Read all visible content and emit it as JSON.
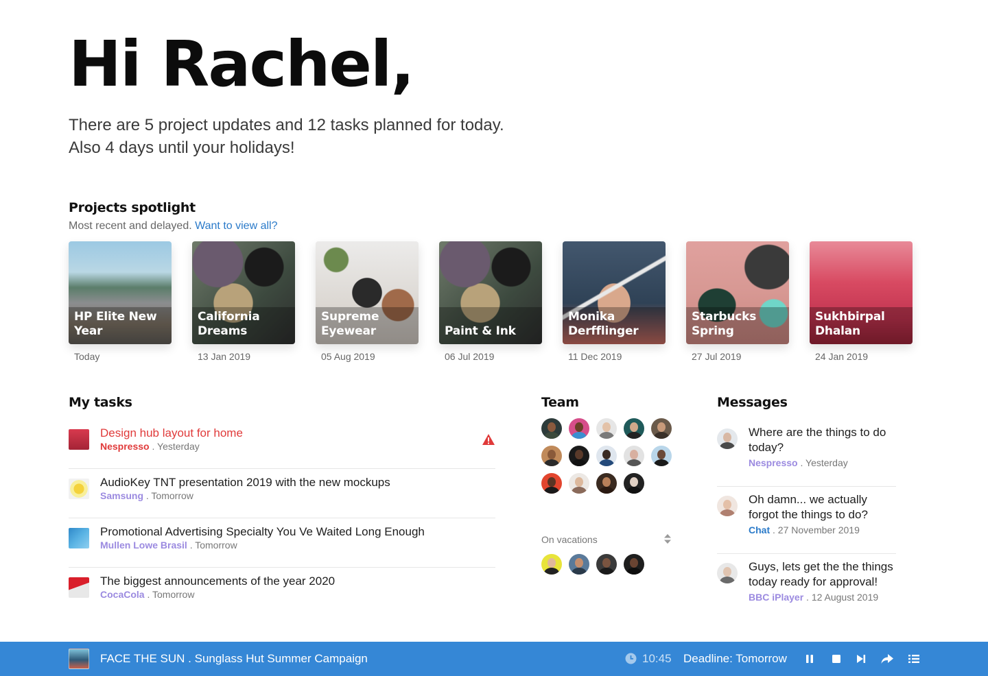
{
  "greeting": "Hi Rachel,",
  "intro": {
    "line1": "There are 5 project updates and 12 tasks planned for today.",
    "line2": "Also 4 days until your holidays!"
  },
  "spotlight": {
    "title": "Projects spotlight",
    "subtitle": "Most recent and delayed.",
    "link": "Want to view all?",
    "projects": [
      {
        "title": "HP Elite New Year",
        "date": "Today"
      },
      {
        "title": "California Dreams",
        "date": "13 Jan 2019"
      },
      {
        "title": "Supreme Eyewear",
        "date": "05 Aug 2019"
      },
      {
        "title": "Paint & Ink",
        "date": "06 Jul 2019"
      },
      {
        "title": "Monika Derfflinger",
        "date": "11 Dec 2019"
      },
      {
        "title": "Starbucks Spring",
        "date": "27 Jul 2019"
      },
      {
        "title": "Sukhbirpal Dhalan",
        "date": "24 Jan 2019"
      }
    ]
  },
  "tasks": {
    "title": "My tasks",
    "items": [
      {
        "title": "Design hub layout for home",
        "client": "Nespresso",
        "when": " . Yesterday"
      },
      {
        "title": "AudioKey TNT presentation 2019 with the new mockups",
        "client": "Samsung",
        "when": " . Tomorrow"
      },
      {
        "title": "Promotional Advertising Specialty You Ve Waited Long Enough",
        "client": "Mullen Lowe Brasil",
        "when": " . Tomorrow"
      },
      {
        "title": "The biggest announcements of the year 2020",
        "client": "CocaCola",
        "when": " . Tomorrow"
      }
    ]
  },
  "team": {
    "title": "Team",
    "vacations_label": "On vacations"
  },
  "messages": {
    "title": "Messages",
    "items": [
      {
        "text": "Where are the things to do today?",
        "client": "Nespresso",
        "when": " . Yesterday"
      },
      {
        "text": "Oh damn... we actually forgot the things to do?",
        "client": "Chat",
        "when": " . 27 November 2019"
      },
      {
        "text": "Guys, lets get the the things today ready for approval!",
        "client": "BBC iPlayer",
        "when": " . 12 August 2019"
      }
    ]
  },
  "footer": {
    "campaign": "FACE THE SUN . Sunglass Hut Summer Campaign",
    "time": "10:45",
    "deadline": "Deadline: Tomorrow"
  },
  "colors": {
    "accent": "#3587d6",
    "link": "#2a7ac9",
    "client": "#9b8ae0",
    "urgent": "#e03a3a"
  }
}
